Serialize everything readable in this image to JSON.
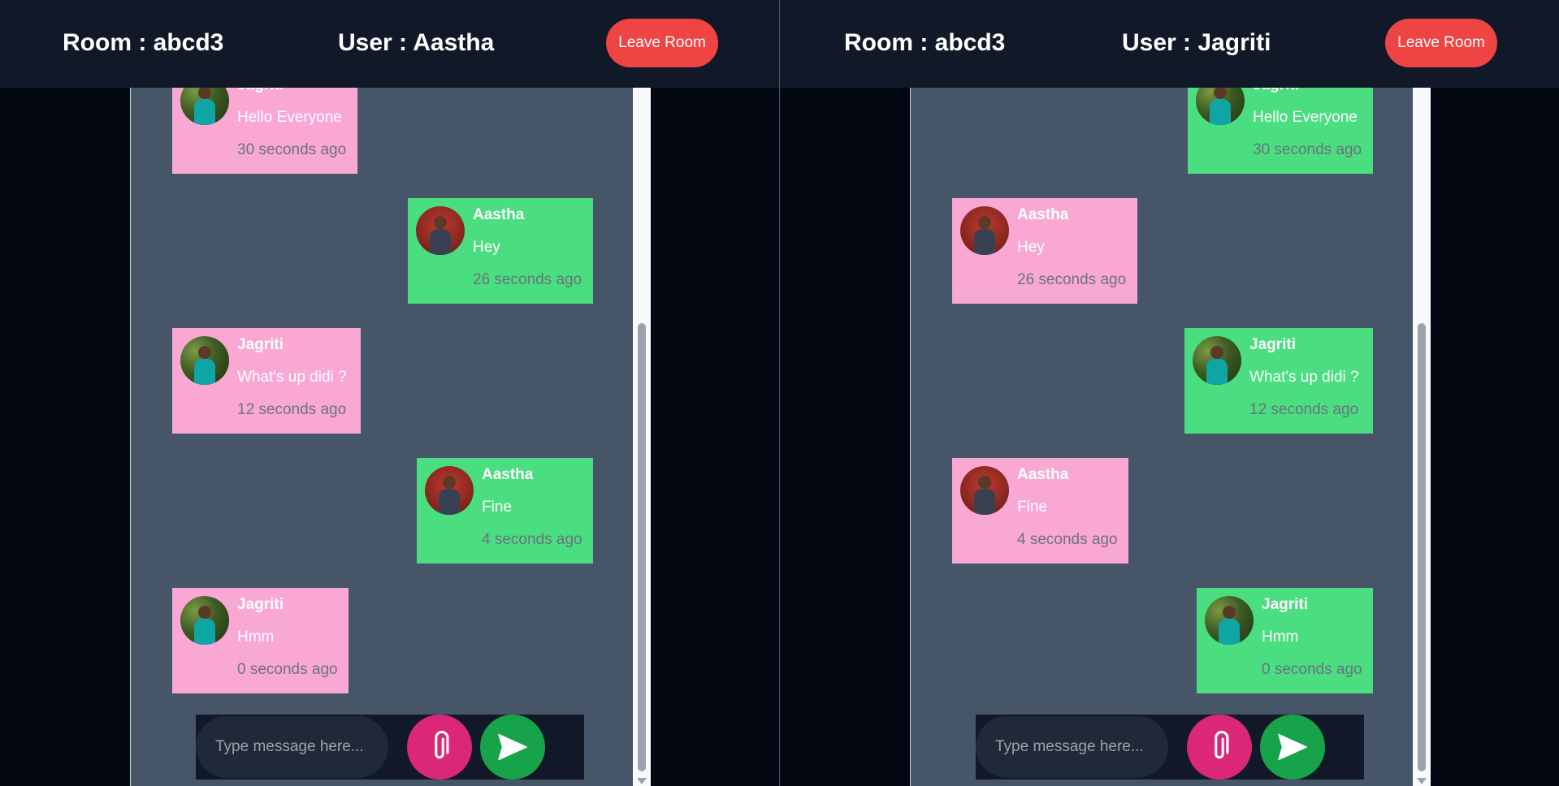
{
  "placeholder": "Type message here...",
  "leave_label": "Leave Room",
  "panes": [
    {
      "room": "Room : abcd3",
      "user": "User : Aastha",
      "messages": [
        {
          "name": "Jagriti",
          "text": "Hello Everyone",
          "time": "30 seconds ago",
          "side": "left",
          "color": "#f9a8d4"
        },
        {
          "name": "Aastha",
          "text": "Hey",
          "time": "26 seconds ago",
          "side": "right",
          "color": "#4ade80"
        },
        {
          "name": "Jagriti",
          "text": "What's up didi ?",
          "time": "12 seconds ago",
          "side": "left",
          "color": "#f9a8d4"
        },
        {
          "name": "Aastha",
          "text": "Fine",
          "time": "4 seconds ago",
          "side": "right",
          "color": "#4ade80"
        },
        {
          "name": "Jagriti",
          "text": "Hmm",
          "time": "0 seconds ago",
          "side": "left",
          "color": "#f9a8d4"
        }
      ]
    },
    {
      "room": "Room : abcd3",
      "user": "User : Jagriti",
      "messages": [
        {
          "name": "Jagriti",
          "text": "Hello Everyone",
          "time": "30 seconds ago",
          "side": "right",
          "color": "#4ade80"
        },
        {
          "name": "Aastha",
          "text": "Hey",
          "time": "26 seconds ago",
          "side": "left",
          "color": "#f9a8d4"
        },
        {
          "name": "Jagriti",
          "text": "What's up didi ?",
          "time": "12 seconds ago",
          "side": "right",
          "color": "#4ade80"
        },
        {
          "name": "Aastha",
          "text": "Fine",
          "time": "4 seconds ago",
          "side": "left",
          "color": "#f9a8d4"
        },
        {
          "name": "Jagriti",
          "text": "Hmm",
          "time": "0 seconds ago",
          "side": "right",
          "color": "#4ade80"
        }
      ]
    }
  ],
  "icons": {
    "attach": "paperclip-icon",
    "send": "send-icon"
  }
}
